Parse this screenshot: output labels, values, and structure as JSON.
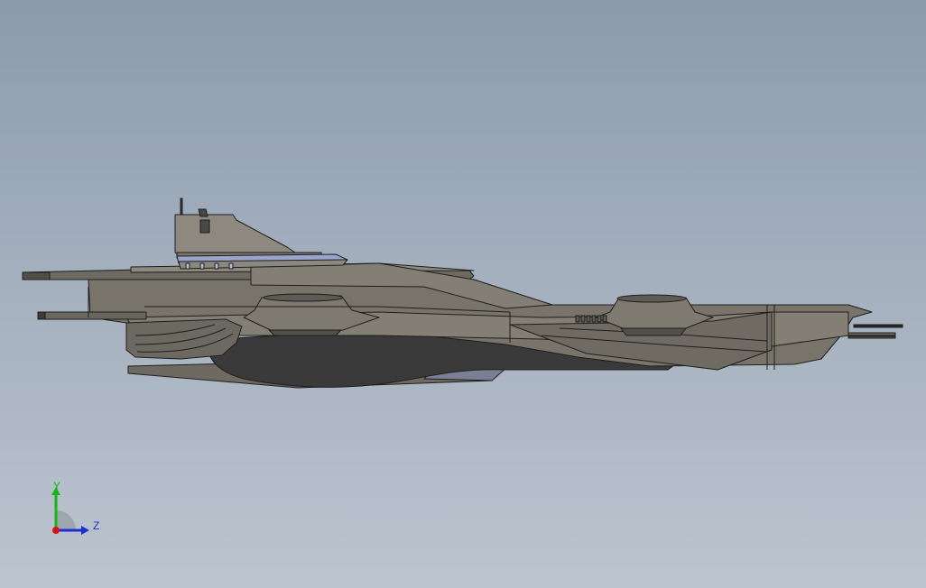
{
  "viewport": {
    "background_top": "#8c9aac",
    "background_bottom": "#bcc4cf"
  },
  "model": {
    "hull_color": "#78746a",
    "hull_light": "#8d897e",
    "hull_dark": "#4a4843",
    "underside": "#3a3a3a",
    "accent_blue": "#9aa3c9",
    "edge_color": "#1e1e1e"
  },
  "triad": {
    "y_label": "Y",
    "z_label": "Z",
    "y_color": "#18b418",
    "z_color": "#1a2fd0",
    "x_color": "#d01818"
  }
}
